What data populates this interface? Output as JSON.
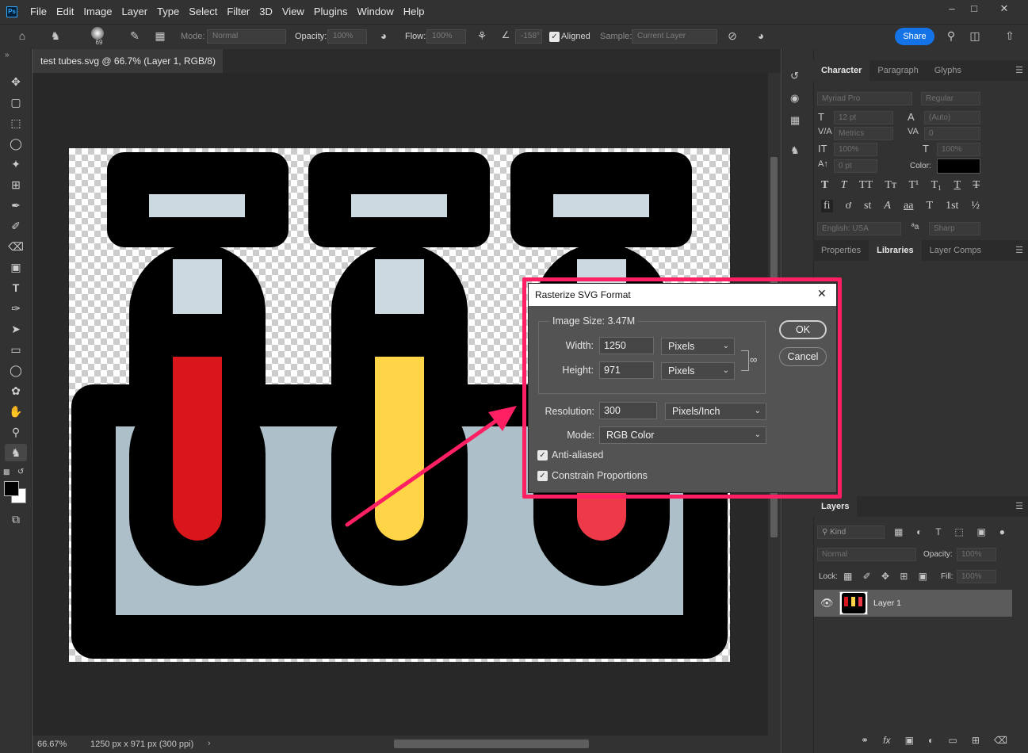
{
  "app": {
    "logo": "Ps"
  },
  "menu": [
    "File",
    "Edit",
    "Image",
    "Layer",
    "Type",
    "Select",
    "Filter",
    "3D",
    "View",
    "Plugins",
    "Window",
    "Help"
  ],
  "options": {
    "brush_size": "69",
    "mode_label": "Mode:",
    "mode_value": "Normal",
    "opacity_label": "Opacity:",
    "opacity_value": "100%",
    "flow_label": "Flow:",
    "flow_value": "100%",
    "angle_value": "-158°",
    "aligned_label": "Aligned",
    "sample_label": "Sample:",
    "sample_value": "Current Layer",
    "share_label": "Share"
  },
  "document": {
    "tab_title": "test tubes.svg @ 66.7% (Layer 1, RGB/8)",
    "zoom": "66.67%",
    "info": "1250 px x 971 px (300 ppi)"
  },
  "character_panel": {
    "tabs": [
      "Character",
      "Paragraph",
      "Glyphs"
    ],
    "font_family": "Myriad Pro",
    "font_style": "Regular",
    "size": "12 pt",
    "leading": "(Auto)",
    "kerning": "Metrics",
    "tracking": "0",
    "vscale": "100%",
    "hscale": "100%",
    "baseline": "0 pt",
    "color_label": "Color:",
    "language": "English: USA",
    "aa_label": "ªa",
    "antialias": "Sharp",
    "type_styles": [
      "T",
      "T",
      "TT",
      "Tт",
      "T¹",
      "T₁",
      "T",
      "T"
    ],
    "opentype": [
      "fi",
      "ơ",
      "st",
      "A",
      "aa",
      "T",
      "1st",
      "½"
    ]
  },
  "lib_panel": {
    "tabs": [
      "Properties",
      "Libraries",
      "Layer Comps"
    ]
  },
  "layers_panel": {
    "title": "Layers",
    "filter_kind": "Kind",
    "blend_mode": "Normal",
    "opacity_label": "Opacity:",
    "opacity_value": "100%",
    "lock_label": "Lock:",
    "fill_label": "Fill:",
    "fill_value": "100%",
    "layers": [
      {
        "name": "Layer 1"
      }
    ]
  },
  "dialog": {
    "title": "Rasterize SVG Format",
    "image_size_label": "Image Size: 3.47M",
    "width_label": "Width:",
    "width_value": "1250",
    "width_unit": "Pixels",
    "height_label": "Height:",
    "height_value": "971",
    "height_unit": "Pixels",
    "resolution_label": "Resolution:",
    "resolution_value": "300",
    "resolution_unit": "Pixels/Inch",
    "mode_label": "Mode:",
    "mode_value": "RGB Color",
    "anti_aliased_label": "Anti-aliased",
    "anti_aliased": true,
    "constrain_label": "Constrain Proportions",
    "constrain": true,
    "ok_label": "OK",
    "cancel_label": "Cancel",
    "close_glyph": "✕"
  },
  "colors": {
    "highlight": "#ff1f63",
    "accent": "#1473e6",
    "tube_red": "#d8161b",
    "tube_yellow": "#ffd446",
    "rack_fill": "#adbfc8",
    "cap_fill": "#cdd9e0"
  }
}
